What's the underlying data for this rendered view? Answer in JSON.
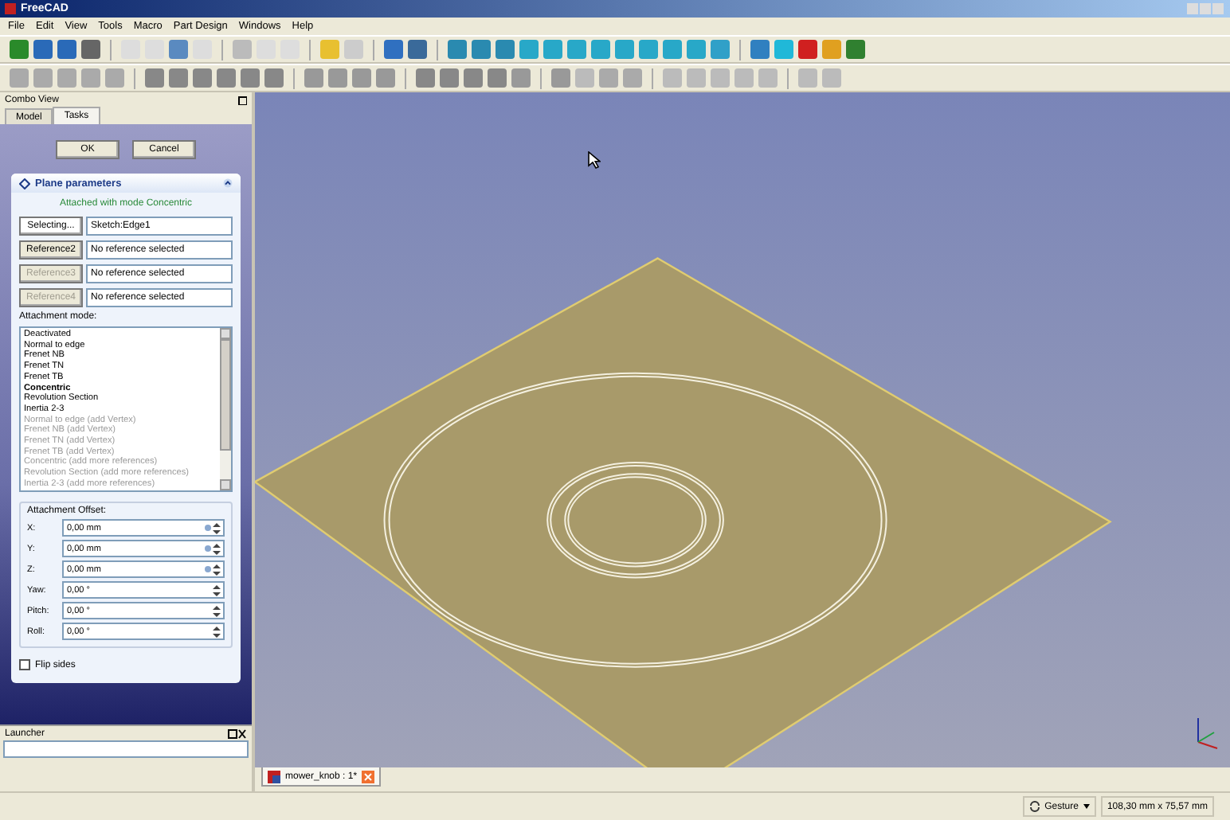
{
  "window": {
    "title": "FreeCAD"
  },
  "menu": [
    "File",
    "Edit",
    "View",
    "Tools",
    "Macro",
    "Part Design",
    "Windows",
    "Help"
  ],
  "combo_view": {
    "title": "Combo View",
    "tabs": [
      {
        "label": "Model",
        "selected": false
      },
      {
        "label": "Tasks",
        "selected": true
      }
    ]
  },
  "task_buttons": [
    "OK",
    "Cancel"
  ],
  "plane_parameters": {
    "title": "Plane parameters",
    "status": "Attached with mode Concentric",
    "references": [
      {
        "button": "Selecting...",
        "value": "Sketch:Edge1",
        "pressed": true,
        "disabled": false
      },
      {
        "button": "Reference2",
        "value": "No reference selected",
        "pressed": false,
        "disabled": false
      },
      {
        "button": "Reference3",
        "value": "No reference selected",
        "pressed": false,
        "disabled": true
      },
      {
        "button": "Reference4",
        "value": "No reference selected",
        "pressed": false,
        "disabled": true
      }
    ],
    "mode_label": "Attachment mode:",
    "modes": [
      {
        "label": "Deactivated",
        "selected": false,
        "disabled": false
      },
      {
        "label": "Normal to edge",
        "selected": false,
        "disabled": false
      },
      {
        "label": "Frenet NB",
        "selected": false,
        "disabled": false
      },
      {
        "label": "Frenet TN",
        "selected": false,
        "disabled": false
      },
      {
        "label": "Frenet TB",
        "selected": false,
        "disabled": false
      },
      {
        "label": "Concentric",
        "selected": true,
        "disabled": false
      },
      {
        "label": "Revolution Section",
        "selected": false,
        "disabled": false
      },
      {
        "label": "Inertia 2-3",
        "selected": false,
        "disabled": false
      },
      {
        "label": "Normal to edge (add Vertex)",
        "selected": false,
        "disabled": true
      },
      {
        "label": "Frenet NB (add Vertex)",
        "selected": false,
        "disabled": true
      },
      {
        "label": "Frenet TN (add Vertex)",
        "selected": false,
        "disabled": true
      },
      {
        "label": "Frenet TB (add Vertex)",
        "selected": false,
        "disabled": true
      },
      {
        "label": "Concentric (add more references)",
        "selected": false,
        "disabled": true
      },
      {
        "label": "Revolution Section (add more references)",
        "selected": false,
        "disabled": true
      },
      {
        "label": "Inertia 2-3 (add more references)",
        "selected": false,
        "disabled": true
      }
    ],
    "offset_title": "Attachment Offset:",
    "offsets": [
      {
        "label": "X:",
        "value": "0,00 mm",
        "linked": true
      },
      {
        "label": "Y:",
        "value": "0,00 mm",
        "linked": true
      },
      {
        "label": "Z:",
        "value": "0,00 mm",
        "linked": true
      },
      {
        "label": "Yaw:",
        "value": "0,00 °",
        "linked": false
      },
      {
        "label": "Pitch:",
        "value": "0,00 °",
        "linked": false
      },
      {
        "label": "Roll:",
        "value": "0,00 °",
        "linked": false
      }
    ],
    "flip": {
      "label": "Flip sides",
      "checked": false
    }
  },
  "launcher": {
    "title": "Launcher"
  },
  "document_tab": {
    "label": "mower_knob : 1*"
  },
  "status_bar": {
    "navigation": "Gesture",
    "dimensions": "108,30 mm x 75,57 mm"
  }
}
